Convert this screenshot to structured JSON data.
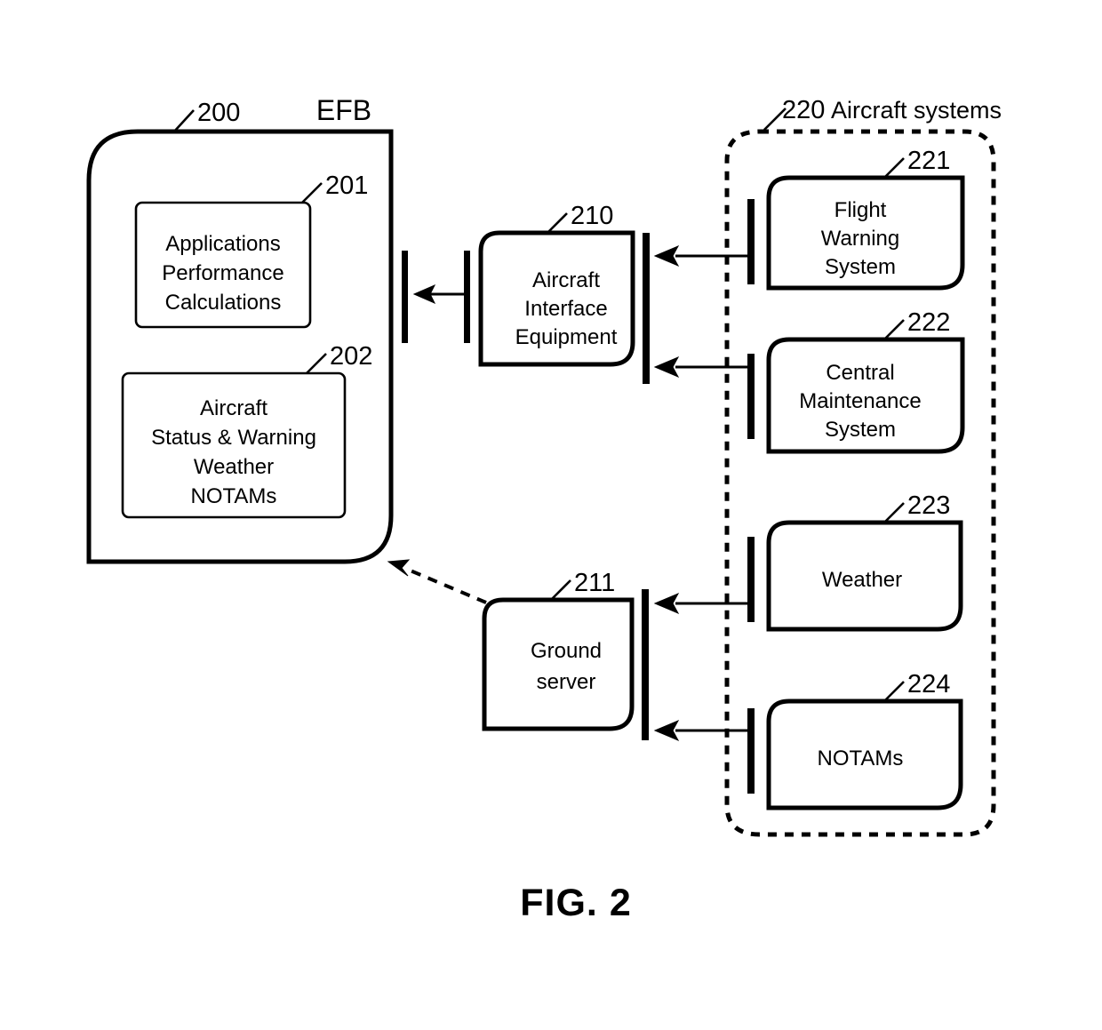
{
  "figure": {
    "caption": "FIG. 2",
    "efb_title": "EFB",
    "aircraft_systems_title": "Aircraft systems"
  },
  "efb": {
    "ref": "200",
    "blocks": [
      {
        "ref": "201",
        "lines": [
          "Applications",
          "Performance",
          "Calculations"
        ]
      },
      {
        "ref": "202",
        "lines": [
          "Aircraft",
          "Status & Warning",
          "Weather",
          "NOTAMs"
        ]
      }
    ]
  },
  "middle": {
    "blocks": [
      {
        "ref": "210",
        "lines": [
          "Aircraft",
          "Interface",
          "Equipment"
        ]
      },
      {
        "ref": "211",
        "lines": [
          "Ground",
          "server"
        ]
      }
    ]
  },
  "aircraft_systems": {
    "ref": "220",
    "blocks": [
      {
        "ref": "221",
        "lines": [
          "Flight",
          "Warning",
          "System"
        ]
      },
      {
        "ref": "222",
        "lines": [
          "Central",
          "Maintenance",
          "System"
        ]
      },
      {
        "ref": "223",
        "lines": [
          "Weather"
        ]
      },
      {
        "ref": "224",
        "lines": [
          "NOTAMs"
        ]
      }
    ]
  },
  "colors": {
    "stroke": "#000000",
    "background": "#ffffff"
  }
}
